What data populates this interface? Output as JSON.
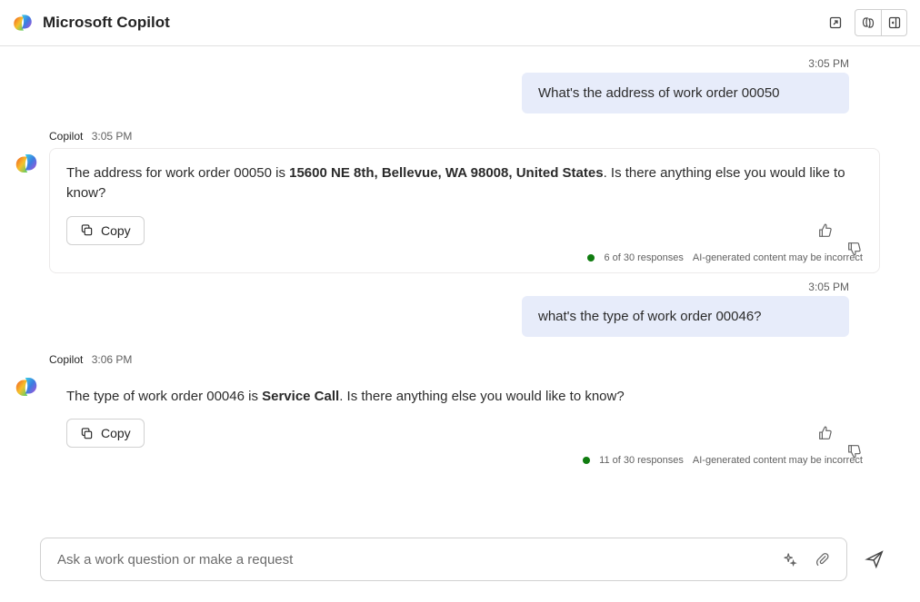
{
  "header": {
    "title": "Microsoft Copilot"
  },
  "chat": [
    {
      "role": "user",
      "time": "3:05 PM",
      "text": "What's the address of work order 00050"
    },
    {
      "role": "bot",
      "name": "Copilot",
      "time": "3:05 PM",
      "pre": "The address for work order 00050 is ",
      "bold": "15600 NE 8th, Bellevue, WA 98008, United States",
      "post": ". Is there anything else you would like to know?",
      "copy_label": "Copy",
      "responses": "6 of 30 responses",
      "disclaimer": "AI-generated content may be incorrect"
    },
    {
      "role": "user",
      "time": "3:05 PM",
      "text": "what's the type of work order 00046?"
    },
    {
      "role": "bot",
      "name": "Copilot",
      "time": "3:06 PM",
      "pre": "The type of work order 00046 is ",
      "bold": "Service Call",
      "post": ". Is there anything else you would like to know?",
      "copy_label": "Copy",
      "responses": "11 of 30 responses",
      "disclaimer": "AI-generated content may be incorrect"
    }
  ],
  "input": {
    "placeholder": "Ask a work question or make a request"
  }
}
